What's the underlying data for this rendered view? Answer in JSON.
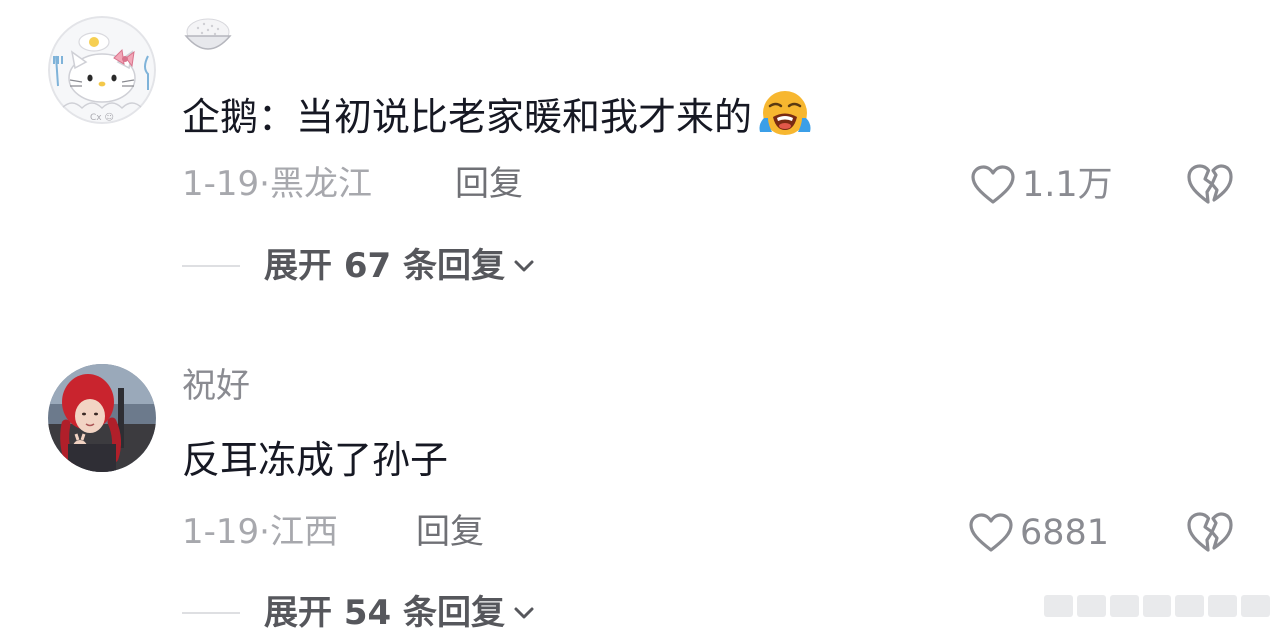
{
  "comments": [
    {
      "username": "",
      "username_emoji": "rice-bowl-emoji",
      "content": "企鹅：当初说比老家暖和我才来的",
      "content_emoji": "loudly-crying-face-emoji",
      "date": "1-19",
      "location": "黑龙江",
      "reply_label": "回复",
      "like_count": "1.1万",
      "expand_label": "展开 67 条回复"
    },
    {
      "username": "祝好",
      "content": "反耳冻成了孙子",
      "date": "1-19",
      "location": "江西",
      "reply_label": "回复",
      "like_count": "6881",
      "expand_label": "展开 54 条回复"
    }
  ],
  "meta_separator": "·",
  "colors": {
    "text_primary": "#161823",
    "text_secondary": "#8a8b91",
    "text_meta": "#a7a8ad",
    "expand_text": "#56575c",
    "background": "#ffffff"
  }
}
